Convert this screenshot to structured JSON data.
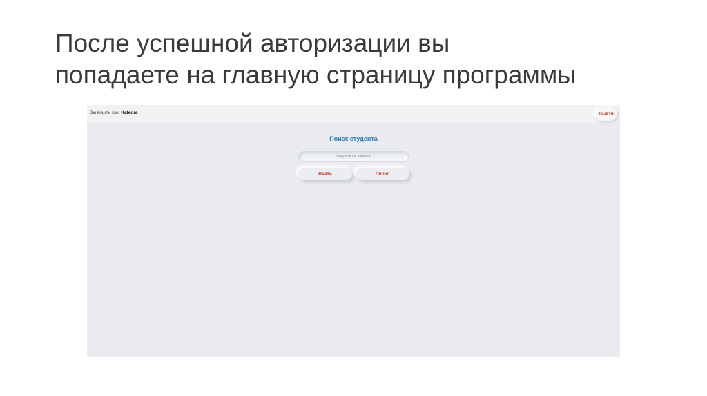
{
  "slide": {
    "title_line1": "После успешной авторизации вы",
    "title_line2": "попадаете на главную страницу программы"
  },
  "app": {
    "header": {
      "logged_in_label": "Вы вошли как:",
      "user_name": "Kafedra",
      "logout_label": "Выйти"
    },
    "search": {
      "title": "Поиск студента",
      "input_value": "",
      "input_placeholder": "Введите № зачетки",
      "find_label": "Найти",
      "reset_label": "Сброс"
    }
  },
  "colors": {
    "accent_blue": "#2e7bb5",
    "button_text_red": "#c0392b",
    "app_background": "#e9ebef"
  }
}
